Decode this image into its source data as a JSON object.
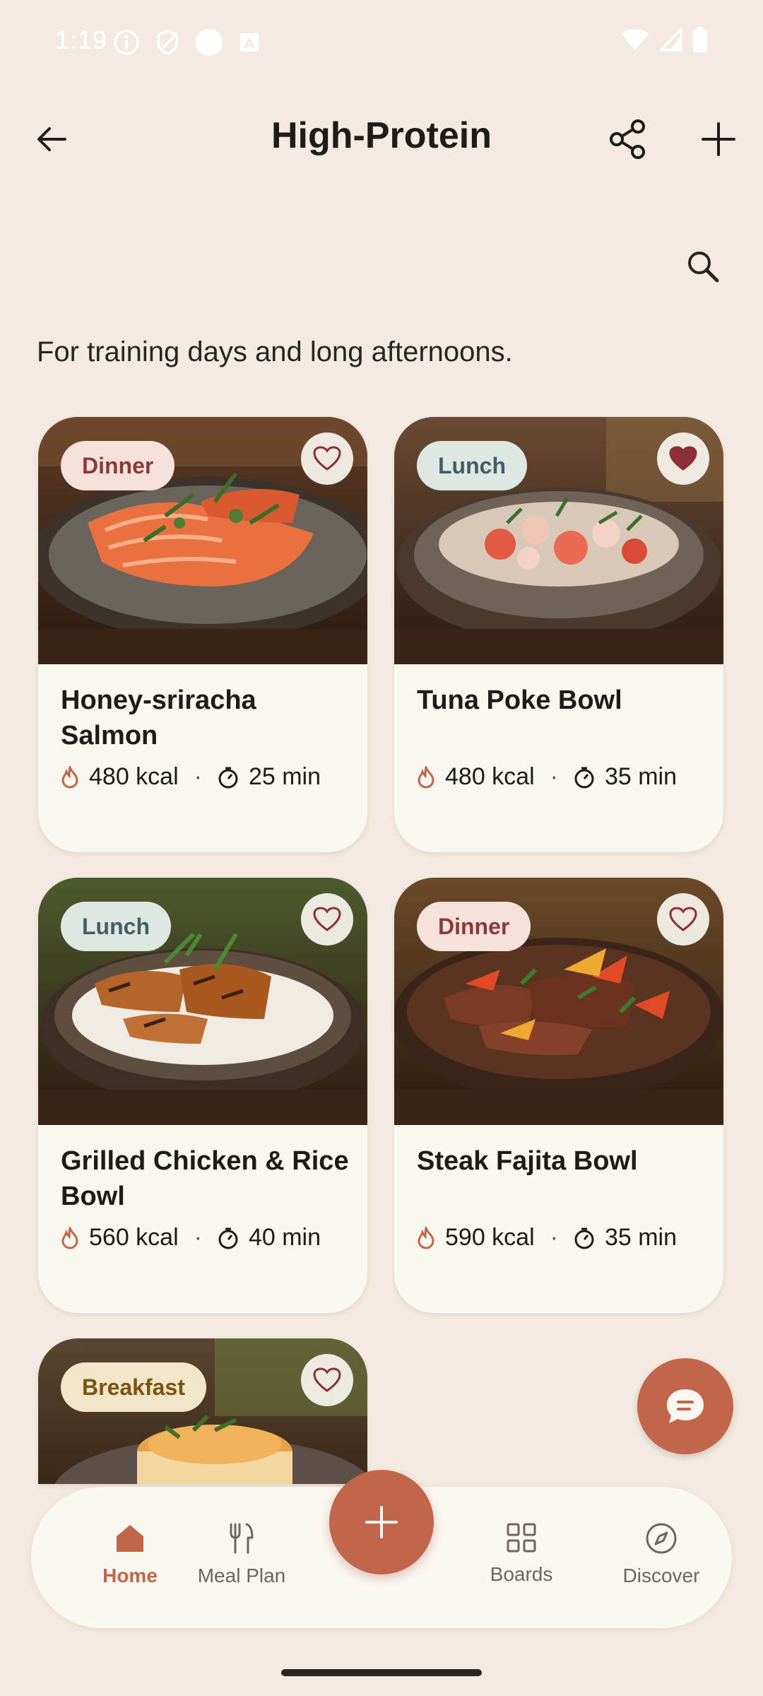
{
  "status_bar": {
    "time": "1:19"
  },
  "header": {
    "title": "High-Protein",
    "back_icon": "arrow-left-icon",
    "share_icon": "share-icon",
    "add_icon": "plus-icon"
  },
  "search": {
    "icon": "search-icon"
  },
  "description": "For training days and long afternoons.",
  "recipes": [
    {
      "title": "Honey-sriracha Salmon",
      "category": "Dinner",
      "kcal": "480 kcal",
      "time": "25 min",
      "favorite": false
    },
    {
      "title": "Tuna Poke Bowl",
      "category": "Lunch",
      "kcal": "480 kcal",
      "time": "35 min",
      "favorite": true
    },
    {
      "title": "Grilled Chicken & Rice Bowl",
      "category": "Lunch",
      "kcal": "560 kcal",
      "time": "40 min",
      "favorite": false
    },
    {
      "title": "Steak Fajita Bowl",
      "category": "Dinner",
      "kcal": "590 kcal",
      "time": "35 min",
      "favorite": false
    },
    {
      "title": "",
      "category": "Breakfast",
      "kcal": "",
      "time": "",
      "favorite": false
    }
  ],
  "nav": {
    "items": [
      {
        "label": "Home",
        "icon": "home-icon",
        "active": true
      },
      {
        "label": "Meal Plan",
        "icon": "utensils-icon",
        "active": false
      },
      {
        "label": "Boards",
        "icon": "grid-icon",
        "active": false
      },
      {
        "label": "Discover",
        "icon": "compass-icon",
        "active": false
      }
    ]
  },
  "colors": {
    "accent": "#c2664b",
    "background": "#f3ebe1",
    "card": "#faf6f0",
    "favorite": "#8b2f35"
  }
}
